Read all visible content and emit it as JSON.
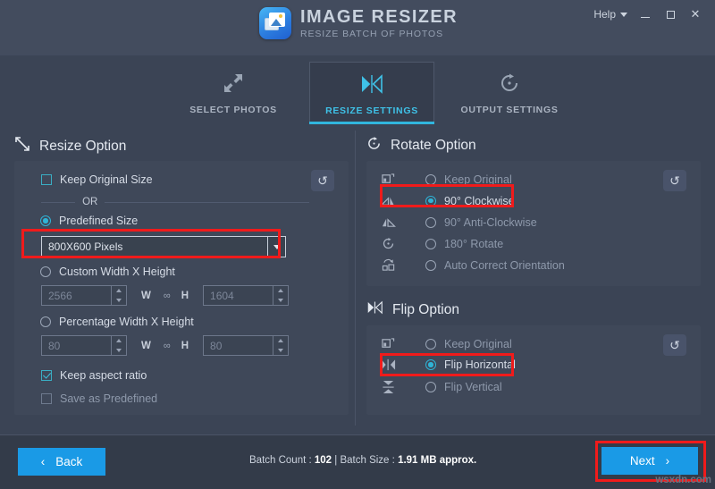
{
  "header": {
    "app_title": "IMAGE RESIZER",
    "app_subtitle": "RESIZE BATCH OF PHOTOS",
    "help_label": "Help",
    "logo_icon": "photo-stack-icon",
    "chevron_icon": "chevron-down-icon",
    "minimize_icon": "minimize-icon",
    "maximize_icon": "maximize-icon",
    "close_icon": "close-icon",
    "close_glyph": "✕"
  },
  "tabs": [
    {
      "label": "SELECT PHOTOS",
      "icon": "expand-arrows-icon",
      "glyph": "⤡",
      "active": false
    },
    {
      "label": "RESIZE SETTINGS",
      "icon": "flip-horizontal-icon",
      "glyph": "▶◀",
      "active": true
    },
    {
      "label": "OUTPUT SETTINGS",
      "icon": "rotate-clockwise-icon",
      "glyph": "↻",
      "active": false
    }
  ],
  "resize_option": {
    "title": "Resize Option",
    "icon": "resize-diagonal-icon",
    "reset_icon": "reset-icon",
    "reset_glyph": "↺",
    "keep_original_label": "Keep Original Size",
    "keep_original_checked": false,
    "or_label": "OR",
    "predefined_label": "Predefined Size",
    "predefined_selected": true,
    "predefined_value": "800X600 Pixels",
    "custom_label": "Custom Width X Height",
    "custom_selected": false,
    "custom_width": "2566",
    "custom_height": "1604",
    "percentage_label": "Percentage Width X Height",
    "percentage_selected": false,
    "percentage_width": "80",
    "percentage_height": "80",
    "w_label": "W",
    "h_label": "H",
    "link_icon": "chain-link-icon",
    "link_glyph": "∞",
    "keep_aspect_label": "Keep aspect ratio",
    "keep_aspect_checked": true,
    "save_predefined_label": "Save as Predefined",
    "save_predefined_checked": false
  },
  "rotate_option": {
    "title": "Rotate Option",
    "icon": "rotate-clockwise-icon",
    "icon_glyph": "↻",
    "reset_icon": "reset-icon",
    "reset_glyph": "↺",
    "items": [
      {
        "label": "Keep Original",
        "icon": "keep-original-icon",
        "glyph": "❑",
        "selected": false
      },
      {
        "label": "90° Clockwise",
        "icon": "rotate-90-cw-icon",
        "glyph": "◢",
        "selected": true
      },
      {
        "label": "90° Anti-Clockwise",
        "icon": "rotate-90-ccw-icon",
        "glyph": "◣",
        "selected": false
      },
      {
        "label": "180° Rotate",
        "icon": "rotate-180-icon",
        "glyph": "↻",
        "selected": false
      },
      {
        "label": "Auto Correct Orientation",
        "icon": "auto-orientation-icon",
        "glyph": "◱",
        "selected": false
      }
    ]
  },
  "flip_option": {
    "title": "Flip Option",
    "icon": "flip-horizontal-icon",
    "icon_glyph": "▶◀",
    "reset_icon": "reset-icon",
    "reset_glyph": "↺",
    "items": [
      {
        "label": "Keep Original",
        "icon": "keep-original-icon",
        "glyph": "❑",
        "selected": false
      },
      {
        "label": "Flip Horizontal",
        "icon": "flip-horizontal-icon",
        "glyph": "▶|◀",
        "selected": true
      },
      {
        "label": "Flip Vertical",
        "icon": "flip-vertical-icon",
        "glyph": "⧖",
        "selected": false
      }
    ]
  },
  "footer": {
    "back_label": "Back",
    "back_icon": "chevron-left-icon",
    "back_glyph": "‹",
    "next_label": "Next",
    "next_icon": "chevron-right-icon",
    "next_glyph": "›",
    "batch_count_label": "Batch Count :",
    "batch_count_value": "102",
    "separator": "|",
    "batch_size_label": "Batch Size :",
    "batch_size_value": "1.91 MB approx.",
    "watermark": "wsxdn.com"
  },
  "colors": {
    "accent": "#31b6de",
    "primary_button": "#1a9ae6",
    "highlight": "#f01b1b",
    "background": "#3b4455",
    "panel": "#3f4859"
  }
}
